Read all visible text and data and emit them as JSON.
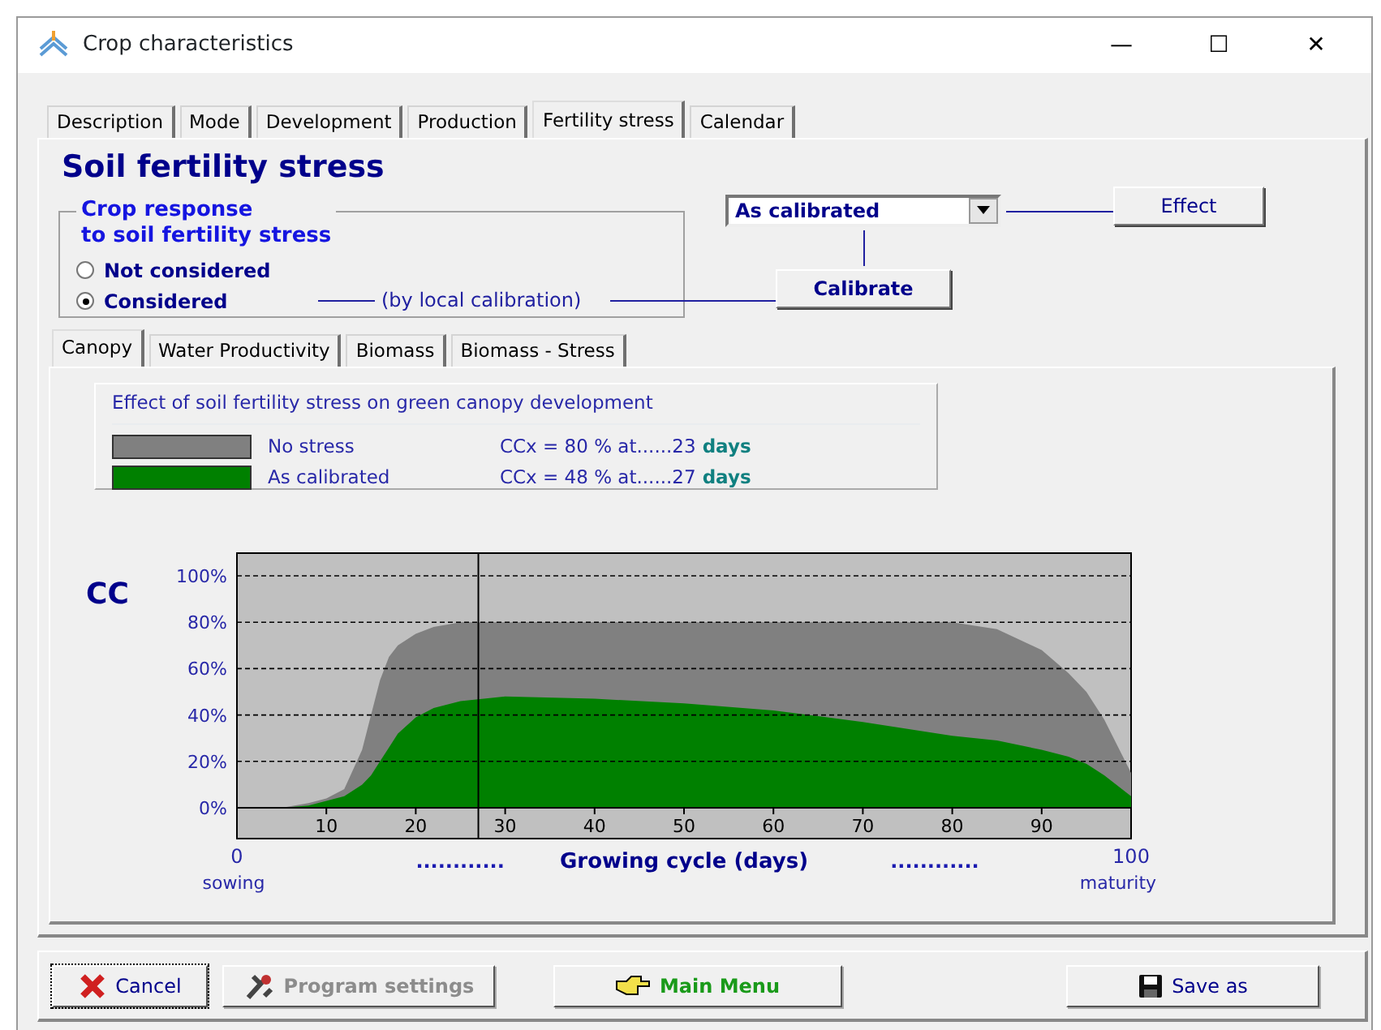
{
  "window": {
    "title": "Crop characteristics",
    "controls": [
      "—",
      "☐",
      "✕"
    ]
  },
  "tabs": [
    {
      "label": "Description",
      "selected": false
    },
    {
      "label": "Mode",
      "selected": false
    },
    {
      "label": "Development",
      "selected": false
    },
    {
      "label": "Production",
      "selected": false
    },
    {
      "label": "Fertility stress",
      "selected": true
    },
    {
      "label": "Calendar",
      "selected": false
    }
  ],
  "heading": "Soil fertility stress",
  "response_group": {
    "title": "Crop response\nto soil fertility stress",
    "options": [
      {
        "label": "Not considered",
        "selected": false
      },
      {
        "label": "Considered",
        "selected": true
      }
    ],
    "note": "(by local calibration)"
  },
  "dropdown": {
    "value": "As calibrated"
  },
  "effect_button": "Effect",
  "calibrate_button": "Calibrate",
  "sub_tabs": [
    {
      "label": "Canopy",
      "selected": true
    },
    {
      "label": "Water Productivity",
      "selected": false
    },
    {
      "label": "Biomass",
      "selected": false
    },
    {
      "label": "Biomass - Stress",
      "selected": false
    }
  ],
  "legend": {
    "title": "Effect of soil fertility stress on green canopy development",
    "rows": [
      {
        "label": "No stress",
        "color": "#808080",
        "value": "CCx = 80 % at......23",
        "unit": "days"
      },
      {
        "label": "As calibrated",
        "color": "#008000",
        "value": "CCx = 48 % at......27",
        "unit": "days"
      }
    ]
  },
  "graph": {
    "start_value": "0",
    "end_value": "100",
    "start_label": "sowing",
    "end_label": "maturity",
    "dots": "............",
    "chart_data": {
      "type": "area",
      "ylabel": "CC",
      "xlabel": "Growing cycle (days)",
      "x": [
        0,
        5,
        8,
        10,
        12,
        14,
        15,
        16,
        17,
        18,
        20,
        22,
        25,
        30,
        40,
        50,
        60,
        70,
        80,
        85,
        90,
        93,
        95,
        97,
        100
      ],
      "series": [
        {
          "color": "#808080",
          "values": [
            0,
            0,
            2,
            4,
            8,
            25,
            40,
            55,
            65,
            70,
            75,
            78,
            80,
            80,
            80,
            80,
            80,
            80,
            80,
            77,
            68,
            58,
            50,
            38,
            15
          ]
        },
        {
          "color": "#008000",
          "values": [
            0,
            0,
            1,
            3,
            5,
            10,
            14,
            20,
            26,
            32,
            39,
            43,
            46,
            48,
            47,
            45,
            42,
            37,
            31,
            29,
            25,
            22,
            19,
            14,
            5
          ]
        }
      ],
      "xlim": [
        0,
        100
      ],
      "ylim": [
        0,
        100
      ],
      "xticks": [
        10,
        20,
        30,
        40,
        50,
        60,
        70,
        80,
        90
      ],
      "grid": true,
      "yticks": [
        {
          "value": 0,
          "label": "0%"
        },
        {
          "value": 20,
          "label": "20%"
        },
        {
          "value": 40,
          "label": "40%"
        },
        {
          "value": 60,
          "label": "60%"
        },
        {
          "value": 80,
          "label": "80%"
        },
        {
          "value": 100,
          "label": "100%"
        }
      ],
      "ref_lines": [
        {
          "axis": "x",
          "value": 27
        }
      ]
    }
  },
  "footer_buttons": [
    {
      "label": "Cancel",
      "kind": "cancel",
      "disabled": false
    },
    {
      "label": "Program settings",
      "kind": "settings",
      "disabled": true
    },
    {
      "label": "Main Menu",
      "kind": "menu",
      "disabled": false
    },
    {
      "label": "Save as",
      "kind": "save",
      "disabled": false
    }
  ]
}
